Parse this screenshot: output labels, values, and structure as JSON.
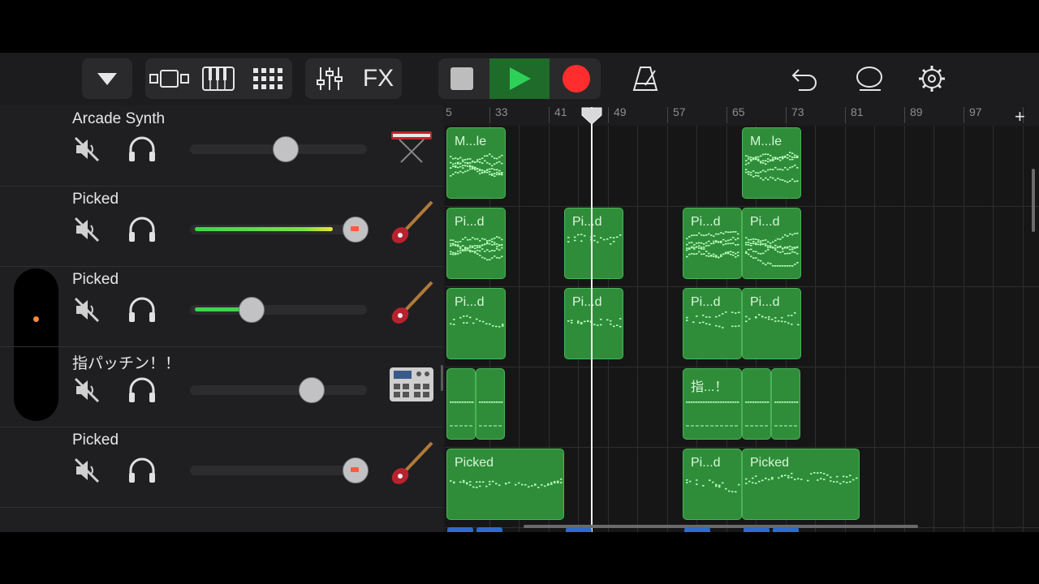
{
  "toolbar": {
    "fx_label": "FX"
  },
  "ruler": {
    "bars": [
      "5",
      "33",
      "41",
      "49",
      "57",
      "65",
      "73",
      "81",
      "89",
      "97"
    ]
  },
  "tracks": [
    {
      "name": "Arcade Synth",
      "volume": 0.55,
      "instrument_icon": "keyboard-synth-icon"
    },
    {
      "name": "Picked",
      "volume": 0.95,
      "instrument_icon": "bass-guitar-icon"
    },
    {
      "name": "Picked",
      "volume": 0.35,
      "instrument_icon": "bass-guitar-icon"
    },
    {
      "name": "指パッチン！！",
      "volume": 0.7,
      "instrument_icon": "drum-machine-icon"
    },
    {
      "name": "Picked",
      "volume": 0.95,
      "instrument_icon": "bass-guitar-icon"
    }
  ],
  "regions": [
    {
      "track": 0,
      "label": "M...le",
      "pattern": "dense"
    },
    {
      "track": 0,
      "label": "M...le",
      "pattern": "dense"
    },
    {
      "track": 1,
      "label": "Pi...d",
      "pattern": "dense"
    },
    {
      "track": 1,
      "label": "Pi...d",
      "pattern": "sparse"
    },
    {
      "track": 1,
      "label": "Pi...d",
      "pattern": "dense"
    },
    {
      "track": 1,
      "label": "Pi...d",
      "pattern": "dense"
    },
    {
      "track": 2,
      "label": "Pi...d",
      "pattern": "sparse"
    },
    {
      "track": 2,
      "label": "Pi...d",
      "pattern": "sparse"
    },
    {
      "track": 2,
      "label": "Pi...d",
      "pattern": "sparse"
    },
    {
      "track": 2,
      "label": "Pi...d",
      "pattern": "sparse"
    },
    {
      "track": 3,
      "label": "",
      "pattern": "flat"
    },
    {
      "track": 3,
      "label": "",
      "pattern": "flat"
    },
    {
      "track": 3,
      "label": "指...！",
      "pattern": "flat"
    },
    {
      "track": 3,
      "label": "",
      "pattern": "flat"
    },
    {
      "track": 3,
      "label": "",
      "pattern": "flat"
    },
    {
      "track": 4,
      "label": "Picked",
      "pattern": "sparse"
    },
    {
      "track": 4,
      "label": "Pi...d",
      "pattern": "sparse"
    },
    {
      "track": 4,
      "label": "Picked",
      "pattern": "sparse"
    }
  ],
  "colors": {
    "region_fill": "#2f8d3a",
    "region_border": "#49b457",
    "record": "#ff2d2d",
    "play": "#2ed158"
  }
}
